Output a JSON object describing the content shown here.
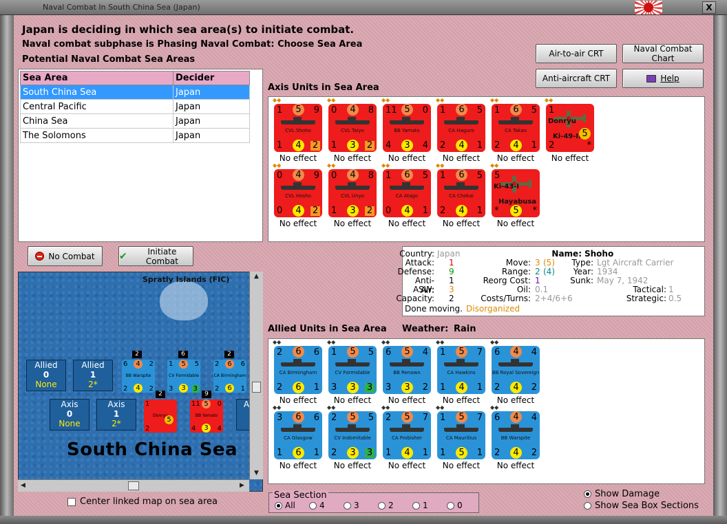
{
  "window": {
    "title": "Naval Combat In South China Sea (Japan)",
    "close": "X"
  },
  "header": {
    "headline": "Japan is deciding in which sea area(s) to initiate combat.",
    "subphase": "Naval combat subphase is Phasing Naval Combat: Choose Sea Area",
    "areas_title": "Potential Naval Combat Sea Areas"
  },
  "buttons": {
    "air_crt": "Air-to-air CRT",
    "naval_chart": "Naval Combat Chart",
    "aa_crt": "Anti-aircraft CRT",
    "help": "Help",
    "no_combat": "No Combat",
    "initiate": "Initiate Combat"
  },
  "sea_table": {
    "headers": [
      "Sea Area",
      "Decider"
    ],
    "rows": [
      [
        "South China Sea",
        "Japan"
      ],
      [
        "Central Pacific",
        "Japan"
      ],
      [
        "China Sea",
        "Japan"
      ],
      [
        "The Solomons",
        "Japan"
      ]
    ]
  },
  "axis_label": "Axis Units in Sea Area",
  "allied_label": "Allied Units in Sea Area",
  "weather_label": "Weather:",
  "weather_value": "Rain",
  "effect_text": "No effect",
  "axis_units": [
    {
      "tl": "1",
      "tc": "5",
      "tr": "9",
      "name": "CVL Shoho",
      "bl": "1",
      "bc": "4",
      "br": "2",
      "sq": true
    },
    {
      "tl": "0",
      "tc": "4",
      "tr": "8",
      "name": "CVL Taiyo",
      "bl": "1",
      "bc": "3",
      "br": "2",
      "sq": true
    },
    {
      "tl": "11",
      "tc": "5",
      "tr": "0",
      "name": "BB Yamato",
      "bl": "4",
      "bc": "3",
      "br": "4",
      "sq": false
    },
    {
      "tl": "1",
      "tc": "6",
      "tr": "5",
      "name": "CA Haguro",
      "bl": "2",
      "bc": "4",
      "br": "1",
      "sq": false
    },
    {
      "tl": "1",
      "tc": "6",
      "tr": "5",
      "name": "CA Takao",
      "bl": "2",
      "bc": "4",
      "br": "1",
      "sq": false
    },
    {
      "plane": true,
      "top": "Donryu",
      "bottom": "Ki-49-II",
      "tl": "1",
      "bl": "2",
      "br": "*",
      "bc": "5"
    },
    {
      "tl": "0",
      "tc": "4",
      "tr": "9",
      "name": "CVL Hosho",
      "bl": "0",
      "bc": "4",
      "br": "2",
      "sq": true
    },
    {
      "tl": "0",
      "tc": "4",
      "tr": "8",
      "name": "CVL Unyo",
      "bl": "1",
      "bc": "3",
      "br": "2",
      "sq": true
    },
    {
      "tl": "1",
      "tc": "6",
      "tr": "5",
      "name": "CA Atago",
      "bl": "0",
      "bc": "4",
      "br": "1",
      "sq": false
    },
    {
      "tl": "1",
      "tc": "6",
      "tr": "5",
      "name": "CA Chokai",
      "bl": "2",
      "bc": "4",
      "br": "1",
      "sq": false
    },
    {
      "plane": true,
      "top": "Ki-43-I",
      "bottom": "Hayabusa",
      "tl": "5",
      "bl": "*",
      "br": "*",
      "bc": "5"
    }
  ],
  "allied_units": [
    {
      "tl": "2",
      "tc": "6",
      "tr": "6",
      "name": "CA Birmingham",
      "bl": "2",
      "bc": "6",
      "br": "1",
      "g": false
    },
    {
      "tl": "1",
      "tc": "5",
      "tr": "5",
      "name": "CV Formidable",
      "bl": "3",
      "bc": "3",
      "br": "3",
      "g": true
    },
    {
      "tl": "6",
      "tc": "5",
      "tr": "4",
      "name": "BB Renown",
      "bl": "3",
      "bc": "3",
      "br": "2",
      "g": false
    },
    {
      "tl": "1",
      "tc": "5",
      "tr": "7",
      "name": "CA Hawkins",
      "bl": "1",
      "bc": "4",
      "br": "1",
      "g": false
    },
    {
      "tl": "6",
      "tc": "4",
      "tr": "4",
      "name": "BB Royal Sovereign",
      "bl": "2",
      "bc": "4",
      "br": "2",
      "g": false
    },
    {
      "tl": "3",
      "tc": "6",
      "tr": "6",
      "name": "CA Glasgow",
      "bl": "1",
      "bc": "6",
      "br": "1",
      "g": false
    },
    {
      "tl": "2",
      "tc": "5",
      "tr": "5",
      "name": "CV Indomitable",
      "bl": "2",
      "bc": "3",
      "br": "3",
      "g": true
    },
    {
      "tl": "2",
      "tc": "5",
      "tr": "7",
      "name": "CA Frobisher",
      "bl": "1",
      "bc": "4",
      "br": "1",
      "g": false
    },
    {
      "tl": "1",
      "tc": "5",
      "tr": "7",
      "name": "CA Mauritius",
      "bl": "1",
      "bc": "5",
      "br": "1",
      "g": false
    },
    {
      "tl": "6",
      "tc": "4",
      "tr": "4",
      "name": "BB Warspite",
      "bl": "2",
      "bc": "4",
      "br": "2",
      "g": false
    }
  ],
  "info": {
    "country_l": "Country:",
    "country": "Japan",
    "attack_l": "Attack:",
    "attack": "1",
    "defense_l": "Defense:",
    "defense": "9",
    "aa_l": "Anti-Air:",
    "aa": "1",
    "asw_l": "ASW:",
    "asw": "3",
    "cap_l": "Capacity:",
    "cap": "2",
    "done": "Done moving.",
    "disorg": "Disorganized",
    "name_l": "Name:",
    "name": "Shoho",
    "move_l": "Move:",
    "move": "3",
    "move2": "(5)",
    "type_l": "Type:",
    "type": "Lgt Aircraft Carrier",
    "range_l": "Range:",
    "range": "2",
    "range2": "(4)",
    "year_l": "Year:",
    "year": "1934",
    "reorg_l": "Reorg Cost:",
    "reorg": "1",
    "sunk_l": "Sunk:",
    "sunk": "May 7, 1942",
    "oil_l": "Oil:",
    "oil": "0.1",
    "costs_l": "Costs/Turns:",
    "costs": "2+4/6+6",
    "tact_l": "Tactical:",
    "tact": "1",
    "strat_l": "Strategic:",
    "strat": "0.5"
  },
  "map": {
    "place": "Spratly Islands (FIC)",
    "seaname": "South China Sea",
    "allied": "Allied",
    "axis": "Axis",
    "zero": "0",
    "one": "1",
    "none": "None",
    "two_star": "2*",
    "m1": {
      "a": "6",
      "ct": "4",
      "b": "2",
      "nm": "BB Warspite",
      "c": "2",
      "cb": "4",
      "d": "2",
      "stack": "2"
    },
    "m2": {
      "a": "1",
      "ct": "5",
      "b": "5",
      "nm": "CV Formidable",
      "c": "3",
      "cb": "3",
      "d": "3",
      "stack": "6"
    },
    "m3": {
      "a": "2",
      "ct": "6",
      "b": "6",
      "nm": "CA Birmingham",
      "c": "2",
      "cb": "6",
      "d": "1",
      "stack": "2"
    },
    "m4": {
      "a": "1",
      "nm": "Donryu",
      "c": "2",
      "cb": "5",
      "stack": "2"
    },
    "m5": {
      "a": "11",
      "ct": "5",
      "b": "0",
      "nm": "BB Yamato",
      "c": "4",
      "cb": "3",
      "d": "4",
      "stack": "9"
    },
    "axis_cut": "A"
  },
  "center_linked": "Center linked map on sea area",
  "sea_section": {
    "legend": "Sea Section",
    "options": [
      "All",
      "4",
      "3",
      "2",
      "1",
      "0"
    ]
  },
  "show_damage": "Show Damage",
  "show_boxes": "Show Sea Box Sections"
}
